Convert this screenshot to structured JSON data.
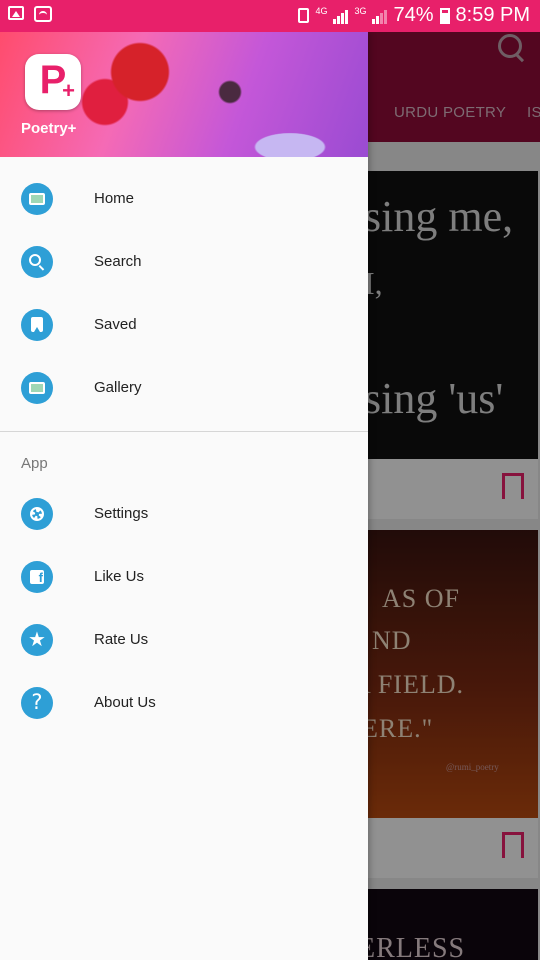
{
  "status_bar": {
    "network_1": "4G",
    "network_2": "3G",
    "battery_percent": "74%",
    "time": "8:59 PM"
  },
  "background_app": {
    "tabs": [
      "URDU POETRY",
      "IS"
    ],
    "card1_lines": [
      "sing me,",
      "I,",
      "",
      "sing 'us'"
    ],
    "card2_lines": [
      "AS OF",
      "ND",
      "A FIELD.",
      "ERE.\""
    ],
    "card2_watermark": "@rumi_poetry",
    "card3_lines": [
      "ERLESS"
    ]
  },
  "drawer": {
    "app_name": "Poetry+",
    "logo_letter": "P",
    "main_items": [
      {
        "label": "Home",
        "icon": "gallery-photo-icon"
      },
      {
        "label": "Search",
        "icon": "search-icon"
      },
      {
        "label": "Saved",
        "icon": "bookmark-icon"
      },
      {
        "label": "Gallery",
        "icon": "gallery-photo-icon"
      }
    ],
    "section_label": "App",
    "app_items": [
      {
        "label": "Settings",
        "icon": "gear-icon"
      },
      {
        "label": "Like Us",
        "icon": "facebook-icon"
      },
      {
        "label": "Rate Us",
        "icon": "star-icon"
      },
      {
        "label": "About Us",
        "icon": "help-icon"
      }
    ]
  },
  "colors": {
    "status_bar": "#e8206a",
    "app_bar": "#8f0b37",
    "menu_icon_bg": "#2e9fd6",
    "accent": "#e8206a"
  }
}
